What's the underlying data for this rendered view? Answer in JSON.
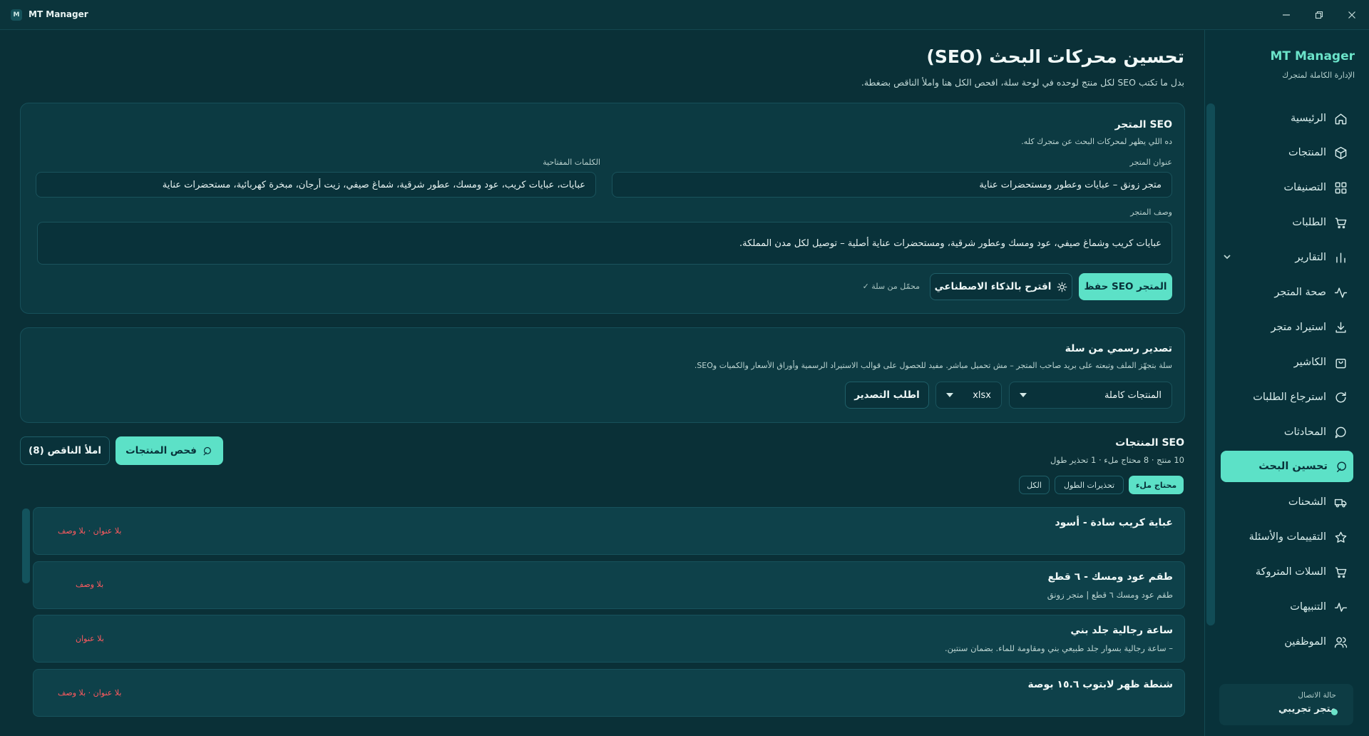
{
  "window": {
    "title": "MT Manager",
    "logo_letter": "M"
  },
  "sidebar": {
    "brand": "MT Manager",
    "brand_sub": "الإدارة الكاملة لمتجرك",
    "items": [
      {
        "label": "الرئيسية",
        "icon": "home-icon"
      },
      {
        "label": "المنتجات",
        "icon": "box-icon"
      },
      {
        "label": "التصنيفات",
        "icon": "grid-icon"
      },
      {
        "label": "الطلبات",
        "icon": "cart-icon"
      },
      {
        "label": "التقارير",
        "icon": "bar-chart-icon"
      },
      {
        "label": "صحة المتجر",
        "icon": "activity-icon"
      },
      {
        "label": "استيراد متجر",
        "icon": "download-icon"
      },
      {
        "label": "الكاشير",
        "icon": "shopping-bag-icon"
      },
      {
        "label": "استرجاع الطلبات",
        "icon": "refresh-icon"
      },
      {
        "label": "المحادثات",
        "icon": "chat-icon"
      },
      {
        "label": "تحسين البحث",
        "icon": "search-icon"
      },
      {
        "label": "الشحنات",
        "icon": "truck-icon"
      },
      {
        "label": "التقييمات والأسئلة",
        "icon": "star-icon"
      },
      {
        "label": "السلات المتروكة",
        "icon": "cart-icon"
      },
      {
        "label": "التنبيهات",
        "icon": "pulse-icon"
      },
      {
        "label": "الموظفين",
        "icon": "users-icon"
      }
    ],
    "active_index": 10,
    "connection": {
      "label": "حالة الاتصال",
      "value": "متجر تجريبي",
      "status_color": "#6be3c9"
    }
  },
  "page": {
    "title": "تحسين محركات البحث (SEO)",
    "subtitle": "بدل ما تكتب SEO لكل منتج لوحده في لوحة سلة، افحص الكل هنا واملأ الناقص بضغطة."
  },
  "store_seo": {
    "title": "SEO المتجر",
    "subtitle": "ده اللي يظهر لمحركات البحث عن متجرك كله.",
    "store_title_label": "عنوان المتجر",
    "store_title_value": "متجر زونق – عبايات وعطور ومستحضرات عناية",
    "keywords_label": "الكلمات المفتاحية",
    "keywords_value": "عبايات، عبايات كريب، عود ومسك، عطور شرقية، شماغ صيفي، زيت أرجان، مبخرة كهربائية، مستحضرات عناية",
    "description_label": "وصف المتجر",
    "description_value": "عبايات كريب وشماغ صيفي، عود ومسك وعطور شرقية، ومستحضرات عناية أصلية – توصيل لكل مدن المملكة.",
    "save_button": "حفظ SEO المتجر",
    "ai_button": "اقترح بالذكاء الاصطناعي",
    "loaded_note": "محمّل من سلة ✓"
  },
  "export": {
    "title": "تصدير رسمي من سلة",
    "subtitle": "سلة بتجهّز الملف وتبعته على بريد صاحب المتجر – مش تحميل مباشر. مفيد للحصول على قوالب الاستيراد الرسمية وأوراق الأسعار والكميات وSEO.",
    "type_selected": "المنتجات كاملة",
    "format_selected": "xlsx",
    "request_button": "اطلب التصدير"
  },
  "products_seo": {
    "title": "SEO المنتجات",
    "stats": "10 منتج · 8 محتاج ملء · 1 تحذير طول",
    "scan_button": "فحص المنتجات",
    "fill_button": "املأ الناقص (8)",
    "filters": [
      {
        "label": "محتاج ملء",
        "active": true
      },
      {
        "label": "تحذيرات الطول",
        "active": false
      },
      {
        "label": "الكل",
        "active": false
      }
    ],
    "rows": [
      {
        "title": "عباية كريب سادة - أسود",
        "subtitle": "",
        "warning": "بلا عنوان · بلا وصف"
      },
      {
        "title": "طقم عود ومسك - ٦ قطع",
        "subtitle": "طقم عود ومسك ٦ قطع | متجر زونق",
        "warning": "بلا وصف"
      },
      {
        "title": "ساعة رجالية جلد بني",
        "subtitle": "– ساعة رجالية بسوار جلد طبيعي بني ومقاومة للماء. بضمان سنتين.",
        "warning": "بلا عنوان"
      },
      {
        "title": "شنطة ظهر لابتوب ١٥.٦ بوصة",
        "subtitle": "",
        "warning": "بلا عنوان · بلا وصف"
      }
    ]
  },
  "colors": {
    "accent": "#5ce1c7",
    "background": "#0a3037",
    "warning": "#ff5a5f"
  }
}
